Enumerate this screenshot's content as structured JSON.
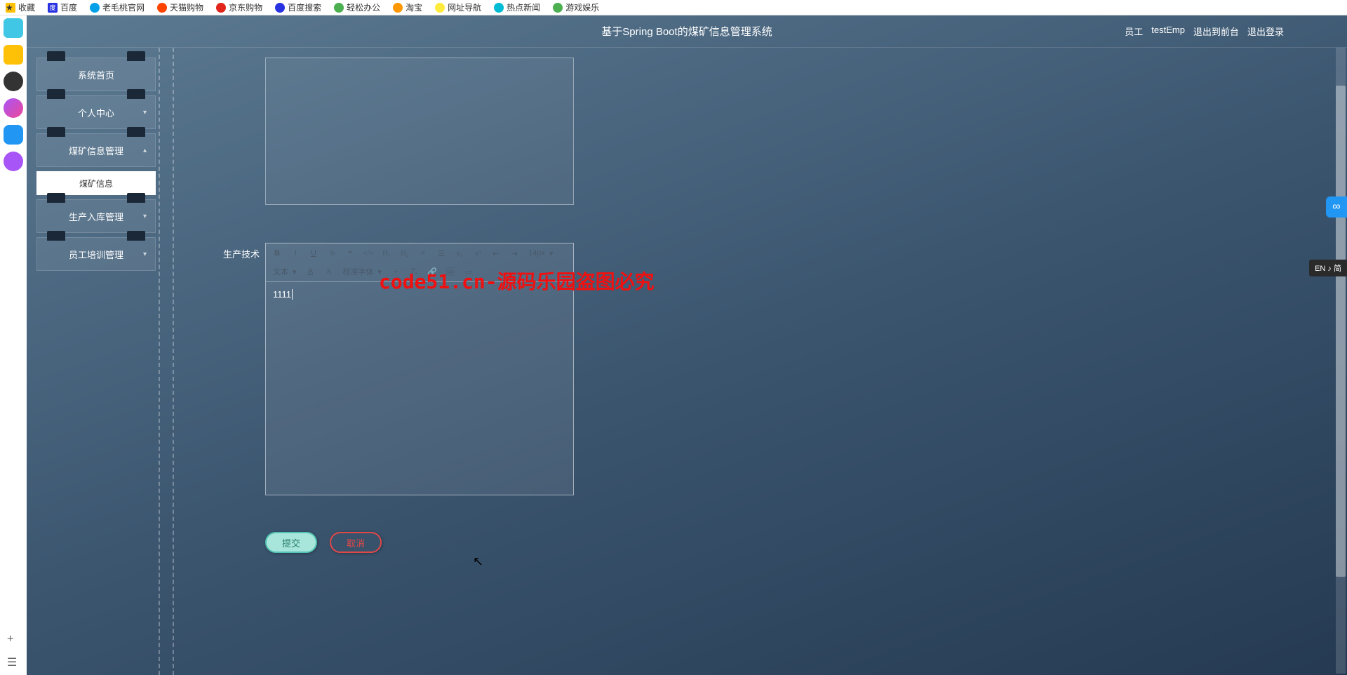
{
  "bookmarks": {
    "favorites": "收藏",
    "items": [
      "百度",
      "老毛桃官网",
      "天猫购物",
      "京东购物",
      "百度搜索",
      "轻松办公",
      "淘宝",
      "网址导航",
      "热点新闻",
      "游戏娱乐"
    ]
  },
  "dock_colors": [
    "#41c7e6",
    "#ffc107",
    "#333",
    "#a566ff",
    "#2196f3",
    "#a855f7"
  ],
  "header": {
    "title": "基于Spring Boot的煤矿信息管理系统",
    "user_role": "员工",
    "user_name": "testEmp",
    "logout_front": "退出到前台",
    "logout": "退出登录"
  },
  "sidebar": {
    "home": "系统首页",
    "personal": "个人中心",
    "coal_mgmt": "煤矿信息管理",
    "coal_info": "煤矿信息",
    "prod_in": "生产入库管理",
    "training": "员工培训管理"
  },
  "form": {
    "label": "生产技术",
    "editor_value": "1111",
    "toolbar": {
      "fontsize": "14px",
      "texttype": "文本",
      "fontfamily": "标准字体"
    }
  },
  "buttons": {
    "submit": "提交",
    "cancel": "取消"
  },
  "watermark": "code51.cn-源码乐园盗图必究",
  "ime": "EN ♪ 简",
  "float_icon": "∞"
}
